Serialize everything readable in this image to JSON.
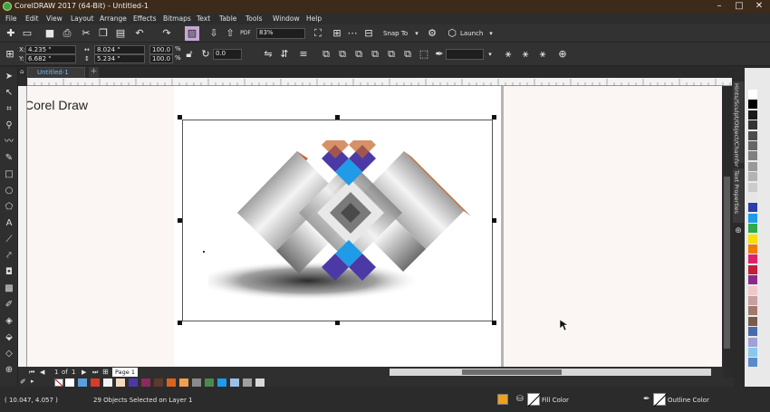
{
  "window": {
    "title": "CorelDRAW 2017 (64-Bit) - Untitled-1"
  },
  "menu": [
    "File",
    "Edit",
    "View",
    "Layout",
    "Arrange",
    "Effects",
    "Bitmaps",
    "Text",
    "Table",
    "Tools",
    "Window",
    "Help"
  ],
  "toolbar": {
    "zoom": "83%",
    "snap_to": "Snap To",
    "launch": "Launch"
  },
  "property_bar": {
    "x": "4.235 \"",
    "y": "6.682 \"",
    "width": "8.024 \"",
    "height": "5.234 \"",
    "scale_w": "100.0",
    "scale_h": "100.0",
    "percent": "%",
    "rotation": "0.0",
    "x_label": "X:",
    "y_label": "Y:"
  },
  "document_tab": {
    "label": "Untitled-1"
  },
  "canvas": {
    "text": "Corel Draw"
  },
  "page_nav": {
    "current": "1",
    "of": "of",
    "total": "1",
    "page_tab": "Page 1"
  },
  "dockers": [
    "Hints/Sculpt/Object/Chamfer",
    "Text Properties"
  ],
  "status": {
    "coordinates": "( 10.047, 4.057 )",
    "selection": "29 Objects Selected on Layer 1",
    "fill_label": "Fill Color",
    "outline_label": "Outline Color"
  },
  "colors": {
    "accent_blue": "#1f9be8",
    "indigo": "#4b3aa6",
    "orange": "#c4632a",
    "title_bar": "#3c2a1a"
  },
  "palette_bottom": [
    "#ffffff",
    "#5aa0e0",
    "#d93b2b",
    "#f2f2f2",
    "#f5d9c0",
    "#4b3aa6",
    "#8c2a5e",
    "#5c3a2e",
    "#d9641e",
    "#f0a050",
    "#8a8a8a",
    "#4a8a4a",
    "#1f9be8",
    "#9ec0e6",
    "#a0a0a0",
    "#d8d8d8"
  ],
  "palette_right": [
    "#ffffff",
    "#000000",
    "#1a1a1a",
    "#333333",
    "#4d4d4d",
    "#666666",
    "#808080",
    "#999999",
    "#b3b3b3",
    "#cccccc",
    "#e6e6e6",
    "#2a3fa8",
    "#1f9be8",
    "#2eaa4a",
    "#f5e000",
    "#f07a00",
    "#e0206a",
    "#c41e3a",
    "#8a2a8a",
    "#f0c8c8",
    "#c8a0a0",
    "#a07a6a",
    "#7a5a4a",
    "#4a6aa8",
    "#a0a0d8",
    "#8ac8e8",
    "#5a8ac8"
  ],
  "icons": [
    "pick-tool-icon",
    "shape-tool-icon",
    "crop-tool-icon",
    "zoom-tool-icon",
    "freehand-tool-icon",
    "rectangle-tool-icon",
    "ellipse-tool-icon",
    "polygon-tool-icon",
    "text-tool-icon",
    "parallel-dimension-icon",
    "connector-tool-icon",
    "shadow-tool-icon",
    "transparency-tool-icon",
    "eyedropper-tool-icon",
    "interactive-fill-icon",
    "smart-fill-icon"
  ]
}
